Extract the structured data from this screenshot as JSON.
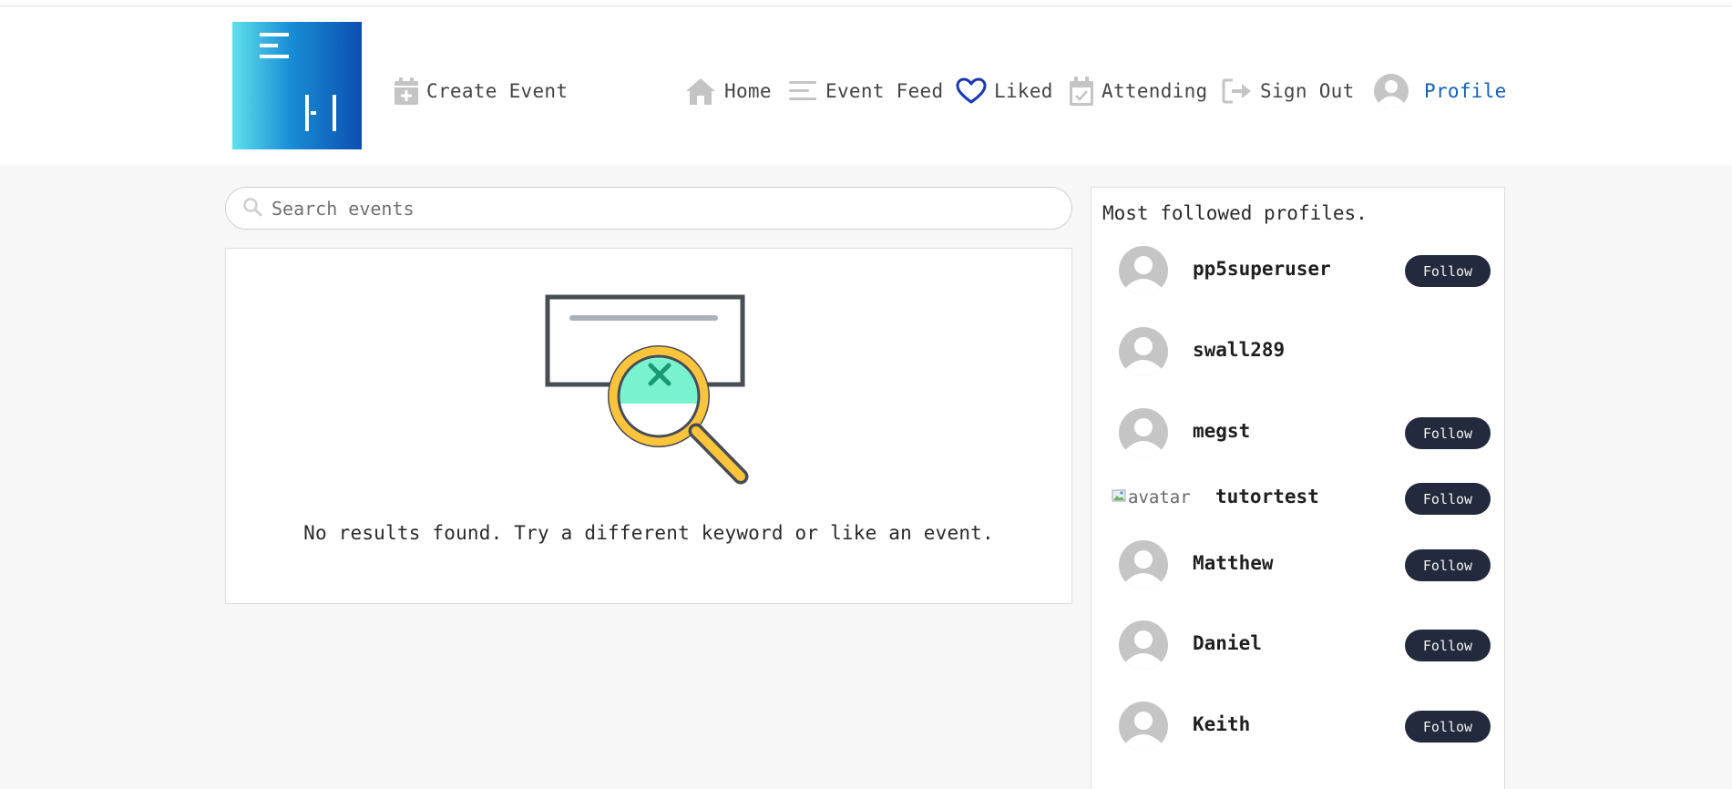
{
  "nav": {
    "create_event": "Create Event",
    "home": "Home",
    "event_feed": "Event Feed",
    "liked": "Liked",
    "attending": "Attending",
    "sign_out": "Sign Out",
    "profile": "Profile"
  },
  "search": {
    "placeholder": "Search events",
    "value": ""
  },
  "results": {
    "empty_message": "No results found. Try a different keyword or like an event."
  },
  "sidebar": {
    "title": "Most followed profiles.",
    "follow_label": "Follow",
    "profiles": [
      {
        "name": "pp5superuser",
        "has_follow": true,
        "avatar": "default"
      },
      {
        "name": "swall289",
        "has_follow": false,
        "avatar": "default"
      },
      {
        "name": "megst",
        "has_follow": true,
        "avatar": "default"
      },
      {
        "name": "tutortest",
        "has_follow": true,
        "avatar": "broken",
        "avatar_alt": "avatar"
      },
      {
        "name": "Matthew",
        "has_follow": true,
        "avatar": "default"
      },
      {
        "name": "Daniel",
        "has_follow": true,
        "avatar": "default"
      },
      {
        "name": "Keith",
        "has_follow": true,
        "avatar": "default"
      }
    ]
  },
  "colors": {
    "accent_liked": "#1a35b8",
    "profile_link": "#1560b8",
    "follow_button": "#232a3d",
    "page_background": "#f7f7f7"
  },
  "icons": {
    "create_event": "calendar-plus-icon",
    "home": "home-icon",
    "event_feed": "list-icon",
    "liked": "heart-icon",
    "attending": "calendar-check-icon",
    "sign_out": "sign-out-icon",
    "profile": "user-avatar-icon",
    "search": "search-icon"
  }
}
